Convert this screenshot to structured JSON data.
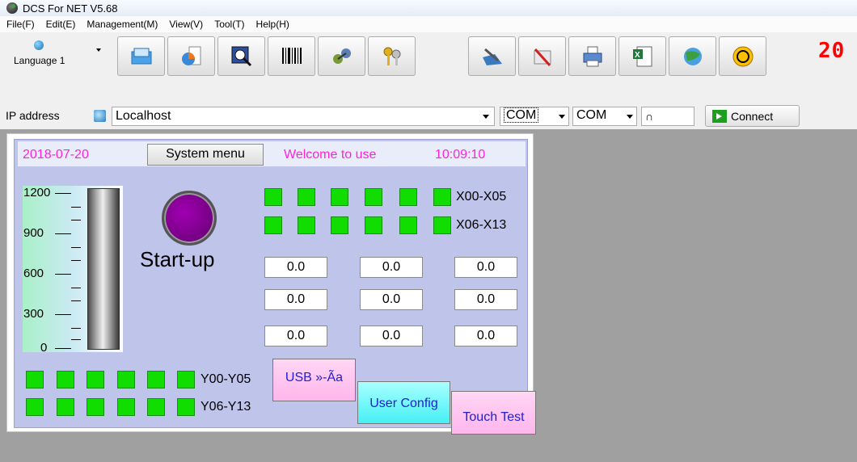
{
  "window": {
    "title": "DCS For NET V5.68"
  },
  "menu": [
    "File(F)",
    "Edit(E)",
    "Management(M)",
    "View(V)",
    "Tool(T)",
    "Help(H)"
  ],
  "toolbar": {
    "language": "Language 1",
    "buttons": [
      "open-icon",
      "chart-icon",
      "sql-search-icon",
      "barcode-icon",
      "network-icon",
      "keys-icon",
      "edit-icon",
      "delete-icon",
      "printer-icon",
      "excel-icon",
      "internet-icon",
      "exit-icon"
    ],
    "led": "20"
  },
  "connection": {
    "ip_label": "IP address",
    "ip_value": "Localhost",
    "com1": "COM",
    "com2": "COM",
    "number_value": "∩",
    "connect_label": "Connect"
  },
  "hmi": {
    "date": "2018-07-20",
    "system_menu": "System menu",
    "welcome": "Welcome to use",
    "time": "10:09:10",
    "scale_labels": [
      "1200",
      "900",
      "600",
      "300",
      "0"
    ],
    "startup": "Start-up",
    "x_labels": [
      "X00-X05",
      "X06-X13"
    ],
    "y_labels": [
      "Y00-Y05",
      "Y06-Y13"
    ],
    "values": [
      [
        "0.0",
        "0.0",
        "0.0"
      ],
      [
        "0.0",
        "0.0",
        "0.0"
      ],
      [
        "0.0",
        "0.0",
        "0.0"
      ]
    ],
    "usb_button": "USB »-Ãa",
    "user_config": "User Config",
    "touch_test": "Touch Test",
    "colors": {
      "indicator": "#11dd00",
      "accent_text": "#ff22dd",
      "lamp": "#7a0088",
      "panel_bg": "#bec4ea"
    }
  }
}
